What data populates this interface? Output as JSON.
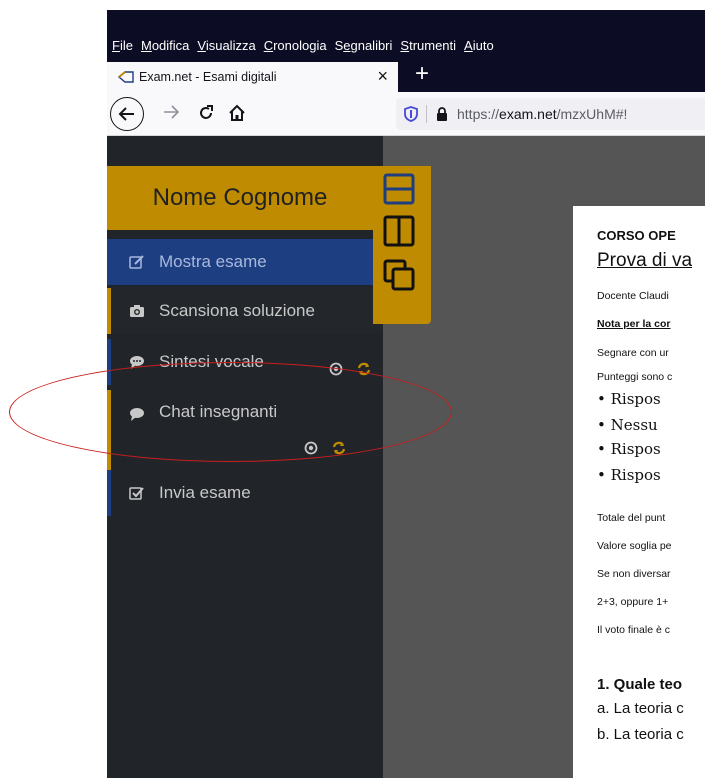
{
  "menubar": {
    "items": [
      {
        "u": "F",
        "rest": "ile"
      },
      {
        "u": "M",
        "rest": "odifica"
      },
      {
        "u": "V",
        "rest": "isualizza"
      },
      {
        "u": "C",
        "rest": "ronologia"
      },
      {
        "pre": "S",
        "u": "e",
        "rest": "gnalibri"
      },
      {
        "u": "S",
        "rest": "trumenti"
      },
      {
        "u": "A",
        "rest": "iuto"
      }
    ]
  },
  "tab": {
    "title": "Exam.net - Esami digitali",
    "close": "×"
  },
  "newtab": "+",
  "urlbar": {
    "prefix": "https://",
    "domain": "exam.net",
    "path": "/mzxUhM#!"
  },
  "sidebar": {
    "student_name": "Nome Cognome",
    "items": [
      {
        "label": "Mostra esame",
        "icon": "edit-icon"
      },
      {
        "label": "Scansiona soluzione",
        "icon": "camera-icon"
      },
      {
        "label": "Sintesi vocale",
        "icon": "speech-bubble-icon"
      },
      {
        "label": "Chat insegnanti",
        "icon": "chat-icon"
      },
      {
        "label": "Invia esame",
        "icon": "checkbox-icon"
      }
    ]
  },
  "document": {
    "title": "CORSO OPE",
    "subtitle": "Prova di va",
    "teacher": "Docente Claudi",
    "note": "Nota per la cor",
    "mark": "Segnare con ur",
    "scores": "Punteggi sono c",
    "bullets": [
      "• Rispos",
      "• Nessu",
      "• Rispos",
      "• Rispos"
    ],
    "total": "Totale del punt",
    "threshold": "Valore soglia pe",
    "if_not": "Se non diversar",
    "combo": "2+3, oppure 1+",
    "final": "Il voto finale è c",
    "question": "1. Quale teo",
    "answer_a": "a. La teoria c",
    "answer_b": "b. La teoria c"
  },
  "colors": {
    "accent_gold": "#bf8b00",
    "active_blue": "#1e3e82",
    "sidebar_bg": "#212529",
    "annotation_red": "#c81e1e"
  }
}
